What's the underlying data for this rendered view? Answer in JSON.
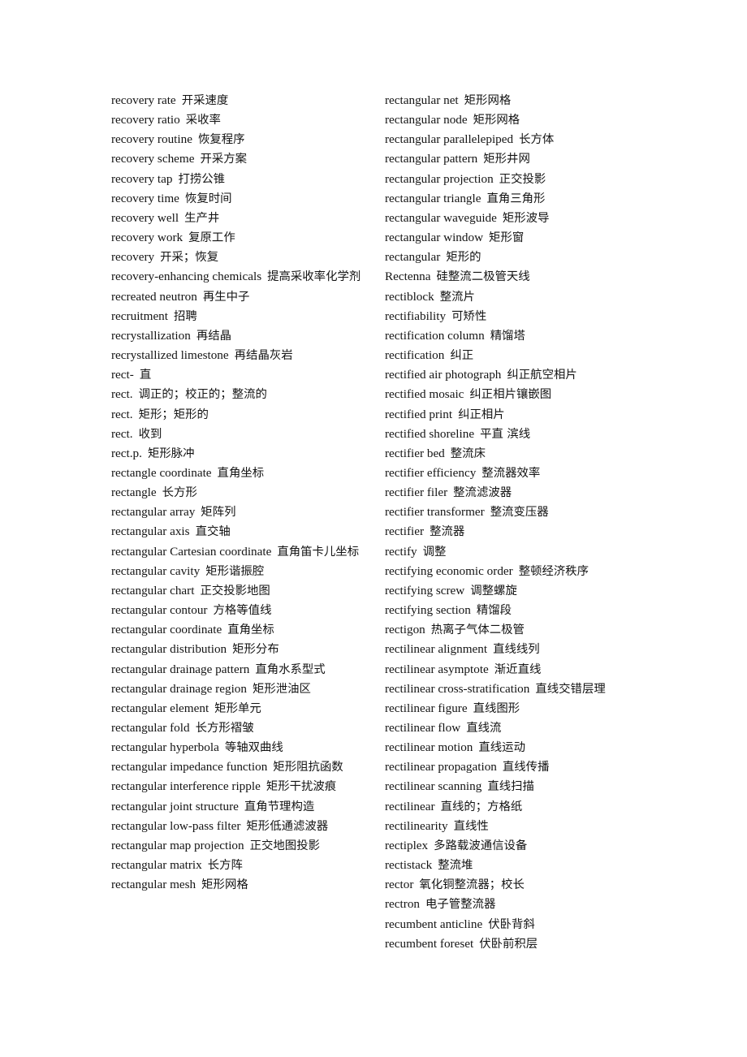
{
  "page": {
    "type": "bilingual-dictionary-page",
    "language_pair": "English-Chinese",
    "background_color": "#ffffff",
    "text_color": "#141414"
  },
  "columns": [
    {
      "name": "left-column",
      "entries": [
        {
          "en": "recovery rate",
          "zh": "开采速度"
        },
        {
          "en": "recovery ratio",
          "zh": "采收率"
        },
        {
          "en": "recovery routine",
          "zh": "恢复程序"
        },
        {
          "en": "recovery scheme",
          "zh": "开采方案"
        },
        {
          "en": "recovery tap",
          "zh": "打捞公锥"
        },
        {
          "en": "recovery time",
          "zh": "恢复时间"
        },
        {
          "en": "recovery well",
          "zh": "生产井"
        },
        {
          "en": "recovery work",
          "zh": "复原工作"
        },
        {
          "en": "recovery",
          "zh": "开采；恢复"
        },
        {
          "en": "recovery-enhancing chemicals",
          "zh": "提高采收率化学剂"
        },
        {
          "en": "recreated neutron",
          "zh": "再生中子"
        },
        {
          "en": "recruitment",
          "zh": "招聘"
        },
        {
          "en": "recrystallization",
          "zh": "再结晶"
        },
        {
          "en": "recrystallized limestone",
          "zh": "再结晶灰岩"
        },
        {
          "en": "rect-",
          "zh": "直"
        },
        {
          "en": "rect.",
          "zh": "调正的；校正的；整流的"
        },
        {
          "en": "rect.",
          "zh": "矩形；矩形的"
        },
        {
          "en": "rect.",
          "zh": "收到"
        },
        {
          "en": "rect.p.",
          "zh": "矩形脉冲"
        },
        {
          "en": "rectangle coordinate",
          "zh": "直角坐标"
        },
        {
          "en": "rectangle",
          "zh": "长方形"
        },
        {
          "en": "rectangular array",
          "zh": "矩阵列"
        },
        {
          "en": "rectangular axis",
          "zh": "直交轴"
        },
        {
          "en": "rectangular Cartesian coordinate",
          "zh": "直角笛卡儿坐标"
        },
        {
          "en": "rectangular cavity",
          "zh": "矩形谐振腔"
        },
        {
          "en": "rectangular chart",
          "zh": "正交投影地图"
        },
        {
          "en": "rectangular contour",
          "zh": "方格等值线"
        },
        {
          "en": "rectangular coordinate",
          "zh": "直角坐标"
        },
        {
          "en": "rectangular distribution",
          "zh": "矩形分布"
        },
        {
          "en": "rectangular drainage pattern",
          "zh": "直角水系型式"
        },
        {
          "en": "rectangular drainage region",
          "zh": "矩形泄油区"
        },
        {
          "en": "rectangular element",
          "zh": "矩形单元"
        },
        {
          "en": "rectangular fold",
          "zh": "长方形褶皱"
        },
        {
          "en": "rectangular hyperbola",
          "zh": "等轴双曲线"
        },
        {
          "en": "rectangular impedance function",
          "zh": "矩形阻抗函数"
        },
        {
          "en": "rectangular interference ripple",
          "zh": "矩形干扰波痕"
        },
        {
          "en": "rectangular joint structure",
          "zh": "直角节理构造"
        },
        {
          "en": "rectangular low-pass filter",
          "zh": "矩形低通滤波器"
        },
        {
          "en": "rectangular map projection",
          "zh": "正交地图投影"
        },
        {
          "en": "rectangular matrix",
          "zh": "长方阵"
        },
        {
          "en": "rectangular mesh",
          "zh": "矩形网格"
        }
      ]
    },
    {
      "name": "right-column",
      "entries": [
        {
          "en": "rectangular net",
          "zh": "矩形网格"
        },
        {
          "en": "rectangular node",
          "zh": "矩形网格"
        },
        {
          "en": "rectangular parallelepiped",
          "zh": "长方体"
        },
        {
          "en": "rectangular pattern",
          "zh": "矩形井网"
        },
        {
          "en": "rectangular projection",
          "zh": "正交投影"
        },
        {
          "en": "rectangular triangle",
          "zh": "直角三角形"
        },
        {
          "en": "rectangular waveguide",
          "zh": "矩形波导"
        },
        {
          "en": "rectangular window",
          "zh": "矩形窗"
        },
        {
          "en": "rectangular",
          "zh": "矩形的"
        },
        {
          "en": "Rectenna",
          "zh": "硅整流二极管天线"
        },
        {
          "en": "rectiblock",
          "zh": "整流片"
        },
        {
          "en": "rectifiability",
          "zh": "可矫性"
        },
        {
          "en": "rectification column",
          "zh": "精馏塔"
        },
        {
          "en": "rectification",
          "zh": "纠正"
        },
        {
          "en": "rectified air photograph",
          "zh": "纠正航空相片"
        },
        {
          "en": "rectified mosaic",
          "zh": "纠正相片镶嵌图"
        },
        {
          "en": "rectified print",
          "zh": "纠正相片"
        },
        {
          "en": "rectified shoreline",
          "zh": "平直 滨线"
        },
        {
          "en": "rectifier bed",
          "zh": "整流床"
        },
        {
          "en": "rectifier efficiency",
          "zh": "整流器效率"
        },
        {
          "en": "rectifier filer",
          "zh": "整流滤波器"
        },
        {
          "en": "rectifier transformer",
          "zh": "整流变压器"
        },
        {
          "en": "rectifier",
          "zh": "整流器"
        },
        {
          "en": "rectify",
          "zh": "调整"
        },
        {
          "en": "rectifying economic order",
          "zh": "整顿经济秩序"
        },
        {
          "en": "rectifying screw",
          "zh": "调整螺旋"
        },
        {
          "en": "rectifying section",
          "zh": "精馏段"
        },
        {
          "en": "rectigon",
          "zh": "热离子气体二极管"
        },
        {
          "en": "rectilinear alignment",
          "zh": "直线线列"
        },
        {
          "en": "rectilinear asymptote",
          "zh": "渐近直线"
        },
        {
          "en": "rectilinear cross-stratification",
          "zh": "直线交错层理"
        },
        {
          "en": "rectilinear figure",
          "zh": "直线图形"
        },
        {
          "en": "rectilinear flow",
          "zh": "直线流"
        },
        {
          "en": "rectilinear motion",
          "zh": "直线运动"
        },
        {
          "en": "rectilinear propagation",
          "zh": "直线传播"
        },
        {
          "en": "rectilinear scanning",
          "zh": "直线扫描"
        },
        {
          "en": "rectilinear",
          "zh": "直线的；方格纸"
        },
        {
          "en": "rectilinearity",
          "zh": "直线性"
        },
        {
          "en": "rectiplex",
          "zh": "多路载波通信设备"
        },
        {
          "en": "rectistack",
          "zh": "整流堆"
        },
        {
          "en": "rector",
          "zh": "氧化铜整流器；校长"
        },
        {
          "en": "rectron",
          "zh": "电子管整流器"
        },
        {
          "en": "recumbent anticline",
          "zh": "伏卧背斜"
        },
        {
          "en": "recumbent foreset",
          "zh": "伏卧前积层"
        }
      ]
    }
  ]
}
